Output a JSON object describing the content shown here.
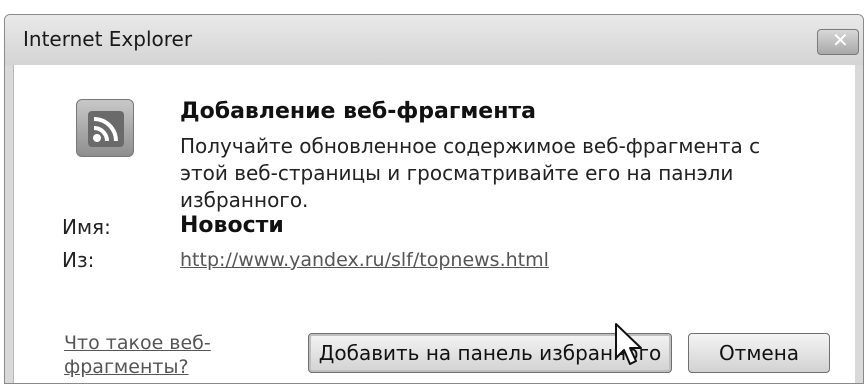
{
  "window": {
    "title": "Internet Explorer",
    "close_label": "✕"
  },
  "dialog": {
    "heading": "Добавление веб-фрагмента",
    "description": "Получайте обновленное содержимое веб-фрагмента с этой веб-страницы и гросматривайте его на панэли избранного.",
    "name_label": "Имя:",
    "name_value": "Новости",
    "from_label": "Из:",
    "from_value": "http://www.yandex.ru/slf/topnews.html",
    "help_link": "Что такое веб-фрагменты?",
    "add_button": "Добавить на панель избранного",
    "cancel_button": "Отмена"
  },
  "icons": {
    "feed": "feed-icon",
    "close": "close-icon",
    "cursor": "mouse-cursor-icon"
  }
}
